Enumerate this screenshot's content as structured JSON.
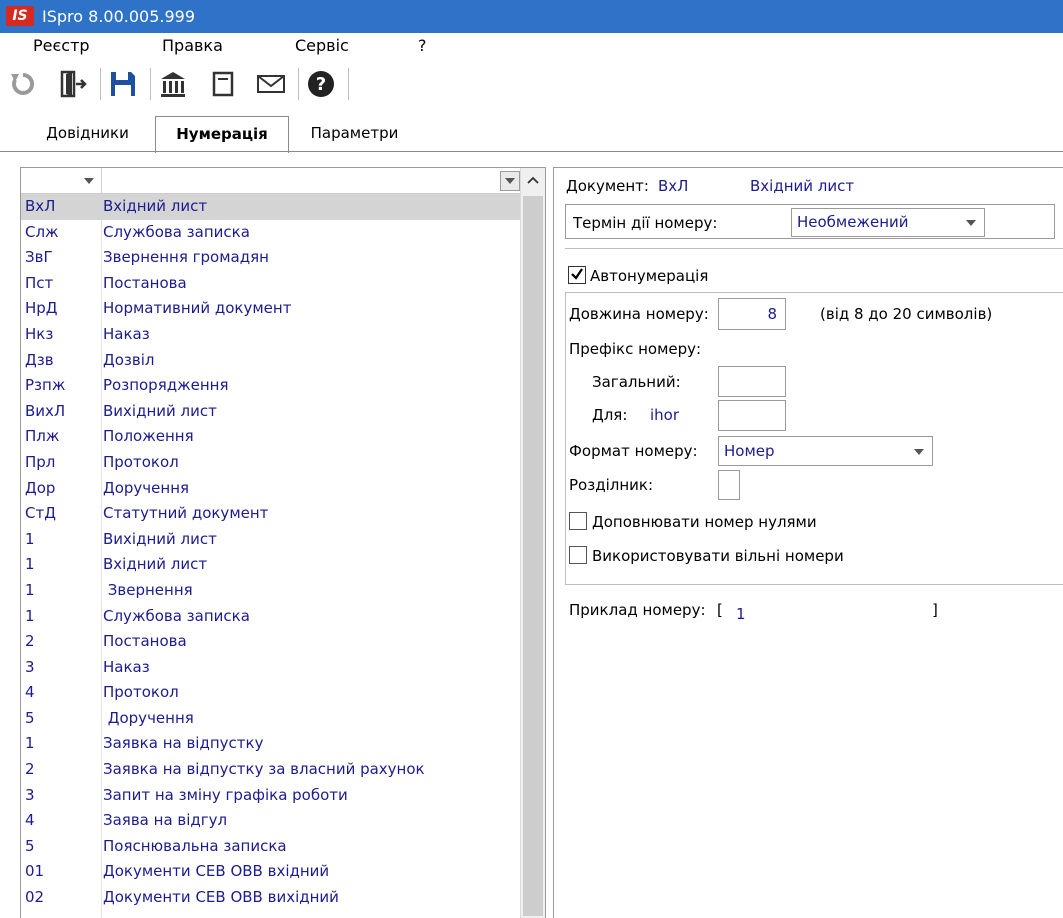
{
  "window": {
    "logo": "IS",
    "title": "ISpro 8.00.005.999"
  },
  "menu": [
    "Реєстр",
    "Правка",
    "Сервіс",
    "?"
  ],
  "toolbar": {
    "icons": [
      "refresh-icon",
      "exit-icon",
      "save-icon",
      "building-icon",
      "document-icon",
      "mail-icon",
      "help-icon"
    ]
  },
  "tabs": [
    "Довідники",
    "Нумерація",
    "Параметри"
  ],
  "active_tab": "Нумерація",
  "list": {
    "selected_index": 0,
    "rows": [
      {
        "code": "ВхЛ",
        "name": "Вхідний лист"
      },
      {
        "code": "Слж",
        "name": "Службова записка"
      },
      {
        "code": "ЗвГ",
        "name": "Звернення громадян"
      },
      {
        "code": "Пст",
        "name": "Постанова"
      },
      {
        "code": "НрД",
        "name": "Нормативний документ"
      },
      {
        "code": "Нкз",
        "name": "Наказ"
      },
      {
        "code": "Дзв",
        "name": "Дозвіл"
      },
      {
        "code": "Рзпж",
        "name": "Розпорядження"
      },
      {
        "code": "ВихЛ",
        "name": "Вихідний лист"
      },
      {
        "code": "Плж",
        "name": "Положення"
      },
      {
        "code": "Прл",
        "name": "Протокол"
      },
      {
        "code": "Дор",
        "name": "Доручення"
      },
      {
        "code": "СтД",
        "name": "Статутний документ"
      },
      {
        "code": "1",
        "name": "Вихідний лист"
      },
      {
        "code": "1",
        "name": "Вхідний лист"
      },
      {
        "code": "1",
        "name": " Звернення"
      },
      {
        "code": "1",
        "name": "Службова записка"
      },
      {
        "code": "2",
        "name": "Постанова"
      },
      {
        "code": "3",
        "name": "Наказ"
      },
      {
        "code": "4",
        "name": "Протокол"
      },
      {
        "code": "5",
        "name": " Доручення"
      },
      {
        "code": "1",
        "name": "Заявка на відпустку"
      },
      {
        "code": "2",
        "name": "Заявка на відпустку за власний рахунок"
      },
      {
        "code": "3",
        "name": "Запит на зміну графіка роботи"
      },
      {
        "code": "4",
        "name": "Заява на відгул"
      },
      {
        "code": "5",
        "name": "Пояснювальна записка"
      },
      {
        "code": "01",
        "name": "Документи СЕВ ОВВ вхідний"
      },
      {
        "code": "02",
        "name": "Документи СЕВ ОВВ вихідний"
      }
    ]
  },
  "detail": {
    "doc_label": "Документ:",
    "doc_code": "ВхЛ",
    "doc_name": "Вхідний лист",
    "term_label": "Термін дії номеру:",
    "term_value": "Необмежений",
    "autonum_label": "Автонумерація",
    "autonum_checked": true,
    "length_label": "Довжина номеру:",
    "length_value": "8",
    "length_hint": "(від 8 до 20 символів)",
    "prefix_label": "Префікс номеру:",
    "general_label": "Загальний:",
    "for_label": "Для:",
    "for_user": "ihor",
    "format_label": "Формат номеру:",
    "format_value": "Номер",
    "separator_label": "Розділник:",
    "pad_zeros_label": "Доповнювати номер нулями",
    "pad_zeros_checked": false,
    "free_numbers_label": "Використовувати вільні номери",
    "free_numbers_checked": false,
    "example_label": "Приклад номеру:",
    "example_open": "[",
    "example_value": "1",
    "example_close": "]"
  }
}
